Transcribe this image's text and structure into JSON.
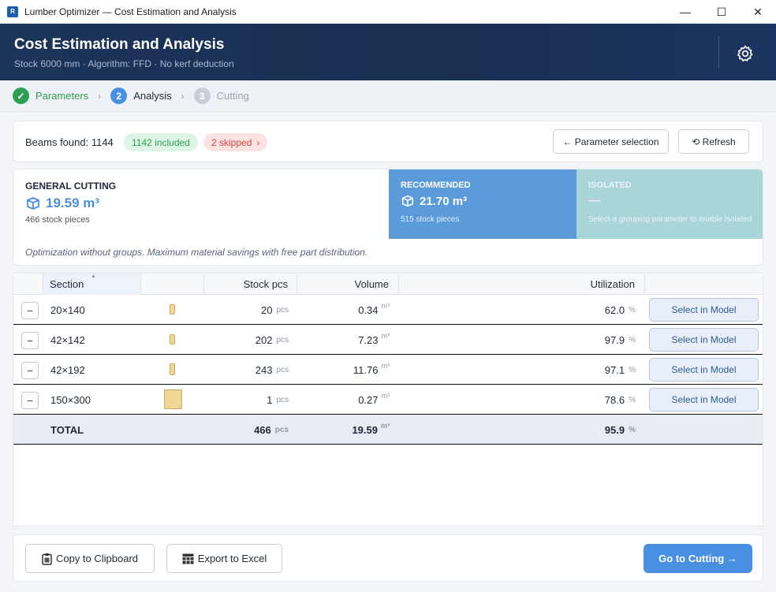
{
  "window": {
    "app_icon_text": "R",
    "title": "Lumber Optimizer — Cost Estimation and Analysis",
    "minimize": "—",
    "maximize": "☐",
    "close": "✕"
  },
  "header": {
    "title": "Cost Estimation and Analysis",
    "subtitle": "Stock 6000 mm · Algorithm: FFD · No kerf deduction",
    "settings_icon": "gear-icon"
  },
  "stepper": {
    "steps": [
      {
        "number": "✓",
        "label": "Parameters",
        "state": "done",
        "color": "#2f9e55"
      },
      {
        "number": "2",
        "label": "Analysis",
        "state": "active",
        "color": "#4a90e2"
      },
      {
        "number": "3",
        "label": "Cutting",
        "state": "pending",
        "color": "#c7ced8"
      }
    ],
    "separator": "›"
  },
  "summary": {
    "beams_found": "Beams found: 1144",
    "included": "1142 included",
    "skipped": "2 skipped",
    "skipped_chevron": "›",
    "param_button": "← Parameter selection",
    "refresh_button": "⟲ Refresh"
  },
  "cards": {
    "general": {
      "title": "GENERAL CUTTING",
      "value": "19.59 m³",
      "sub": "466 stock pieces"
    },
    "recommended": {
      "title": "RECOMMENDED",
      "value": "21.70 m³",
      "sub": "515 stock pieces"
    },
    "isolated": {
      "title": "ISOLATED",
      "value": "—",
      "sub": "Select a grouping parameter to enable isolated"
    },
    "description": "Optimization without groups. Maximum material savings with free part distribution."
  },
  "table": {
    "columns": {
      "section": "Section",
      "stock": "Stock pcs",
      "volume": "Volume",
      "utilization": "Utilization"
    },
    "sort_indicator": "▲",
    "units": {
      "pcs": "pcs",
      "m3": "m³",
      "pct": "%"
    },
    "collapse_symbol": "−",
    "select_label": "Select in Model",
    "rows": [
      {
        "section": "20×140",
        "stock": "20",
        "volume": "0.34",
        "utilization": "62.0"
      },
      {
        "section": "42×142",
        "stock": "202",
        "volume": "7.23",
        "utilization": "97.9"
      },
      {
        "section": "42×192",
        "stock": "243",
        "volume": "11.76",
        "utilization": "97.1"
      },
      {
        "section": "150×300",
        "stock": "1",
        "volume": "0.27",
        "utilization": "78.6"
      }
    ],
    "total": {
      "label": "TOTAL",
      "stock": "466",
      "volume": "19.59",
      "utilization": "95.9"
    }
  },
  "footer": {
    "copy_button": "Copy to Clipboard",
    "export_button": "Export to Excel",
    "go_button": "Go to Cutting →"
  },
  "colors": {
    "header_bg": "#1b3458",
    "accent": "#4a90e2",
    "recommended_card": "#5b9bd9",
    "isolated_card": "#a9d5d8",
    "success": "#2f9e55",
    "danger": "#d84545"
  }
}
